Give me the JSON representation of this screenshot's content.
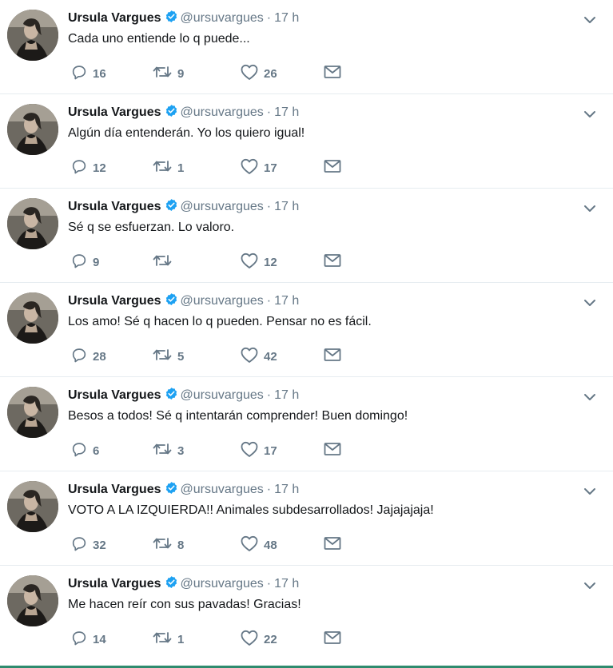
{
  "colors": {
    "verified": "#1da1f2",
    "icon": "#657786",
    "divider": "#e6ecf0",
    "bottom_rule": "#2e8b6e"
  },
  "icons": {
    "reply": "reply-icon",
    "retweet": "retweet-icon",
    "like": "heart-icon",
    "dm": "envelope-icon",
    "more": "chevron-down-icon",
    "verified": "verified-badge-icon"
  },
  "tweets": [
    {
      "name": "Ursula Vargues",
      "handle": "@ursuvargues",
      "sep": "·",
      "time": "17 h",
      "text": "Cada uno entiende lo q puede...",
      "replies": "16",
      "retweets": "9",
      "likes": "26"
    },
    {
      "name": "Ursula Vargues",
      "handle": "@ursuvargues",
      "sep": "·",
      "time": "17 h",
      "text": "Algún día entenderán. Yo los quiero igual!",
      "replies": "12",
      "retweets": "1",
      "likes": "17"
    },
    {
      "name": "Ursula Vargues",
      "handle": "@ursuvargues",
      "sep": "·",
      "time": "17 h",
      "text": "Sé q se esfuerzan. Lo valoro.",
      "replies": "9",
      "retweets": "",
      "likes": "12"
    },
    {
      "name": "Ursula Vargues",
      "handle": "@ursuvargues",
      "sep": "·",
      "time": "17 h",
      "text": "Los amo! Sé q hacen lo q pueden. Pensar no es fácil.",
      "replies": "28",
      "retweets": "5",
      "likes": "42"
    },
    {
      "name": "Ursula Vargues",
      "handle": "@ursuvargues",
      "sep": "·",
      "time": "17 h",
      "text": "Besos a todos! Sé q intentarán comprender! Buen domingo!",
      "replies": "6",
      "retweets": "3",
      "likes": "17"
    },
    {
      "name": "Ursula Vargues",
      "handle": "@ursuvargues",
      "sep": "·",
      "time": "17 h",
      "text": "VOTO A LA IZQUIERDA!! Animales subdesarrollados! Jajajajaja!",
      "replies": "32",
      "retweets": "8",
      "likes": "48"
    },
    {
      "name": "Ursula Vargues",
      "handle": "@ursuvargues",
      "sep": "·",
      "time": "17 h",
      "text": "Me hacen reír con sus pavadas! Gracias!",
      "replies": "14",
      "retweets": "1",
      "likes": "22"
    }
  ]
}
